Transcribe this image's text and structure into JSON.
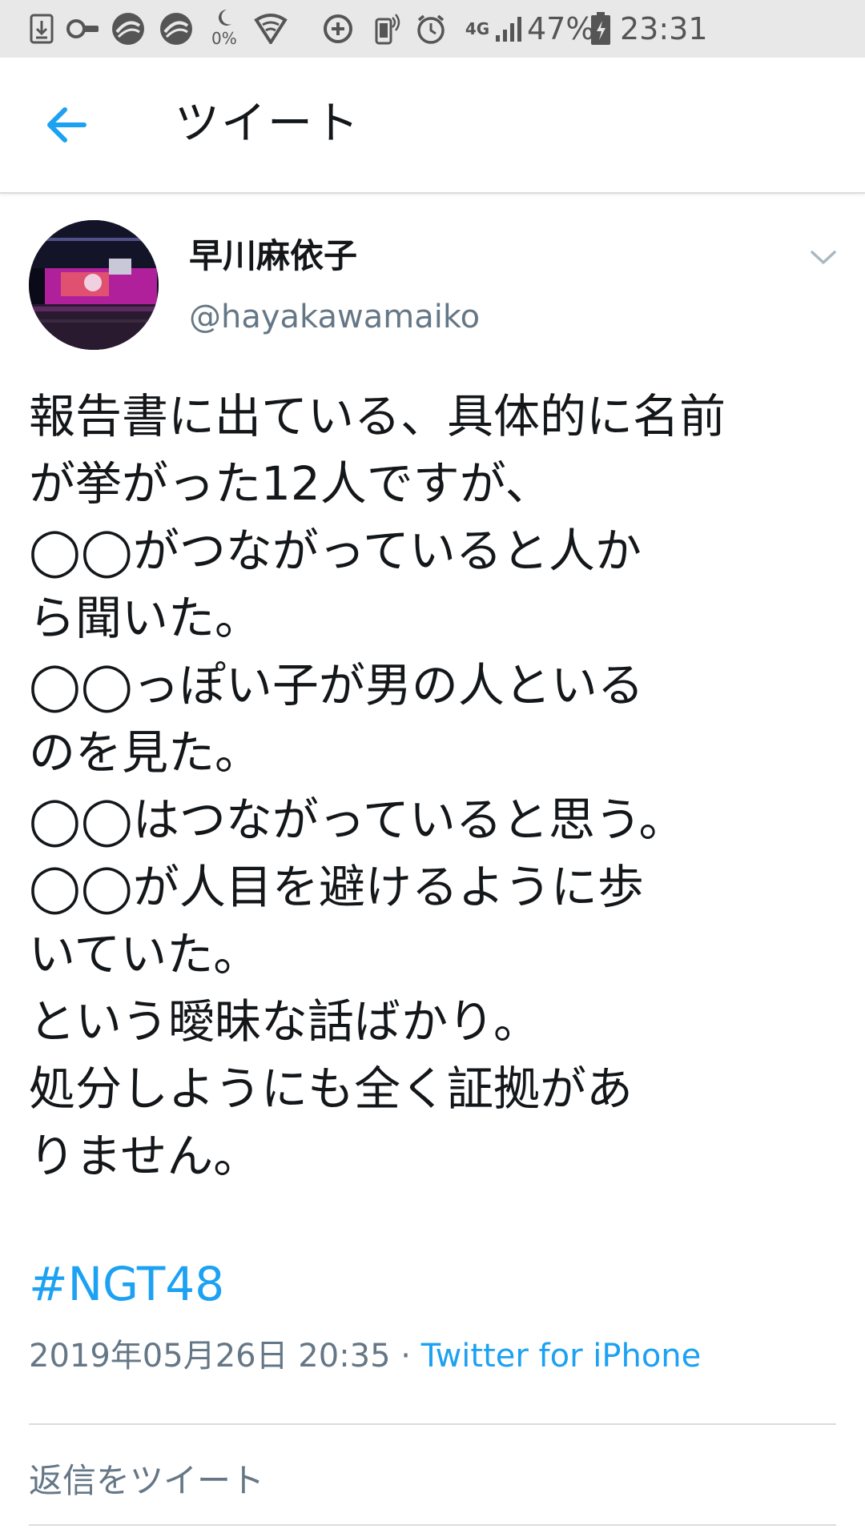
{
  "status_bar": {
    "icons": [
      "download-icon",
      "key-icon",
      "app-icon",
      "app-icon",
      "moon-icon",
      "wifi-icon",
      "data-saver-icon",
      "vibrate-icon",
      "alarm-icon",
      "network-4g-icon",
      "signal-icon",
      "battery-icon"
    ],
    "data_percent_label": "0%",
    "network_label": "4G",
    "battery_percent": "47%",
    "time": "23:31"
  },
  "app_bar": {
    "title": "ツイート",
    "back_icon": "arrow-left-icon"
  },
  "tweet": {
    "display_name": "早川麻依子",
    "handle": "@hayakawamaiko",
    "text_lines": [
      "報告書に出ている、具体的に名前",
      "が挙がった12人ですが、",
      "◯◯がつながっていると人か",
      "ら聞いた。",
      "◯◯っぽい子が男の人といる",
      "のを見た。",
      "◯◯はつながっていると思う。",
      "◯◯が人目を避けるように歩",
      "いていた。",
      "という曖昧な話ばかり。",
      "処分しようにも全く証拠があ",
      "りません。"
    ],
    "hashtag": "#NGT48",
    "timestamp": "2019年05月26日 20:35",
    "separator": " · ",
    "source": "Twitter for iPhone"
  },
  "reply": {
    "placeholder": "返信をツイート"
  },
  "colors": {
    "accent": "#1da1f2",
    "secondary_text": "#657786",
    "status_bar_bg": "#e8e8e8"
  }
}
